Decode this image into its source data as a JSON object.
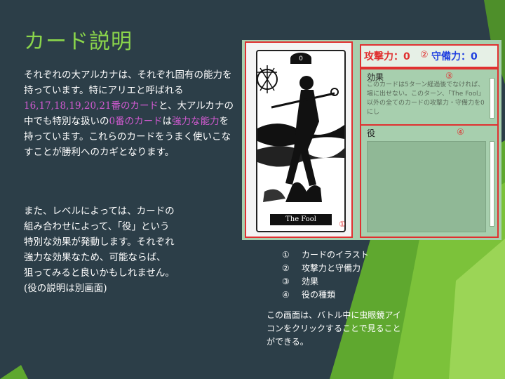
{
  "slide": {
    "title": "カード説明",
    "para1": {
      "a": "それぞれの大アルカナは、それぞれ固有の能力を持っています。特にアリエと呼ばれる",
      "b": "16,17,18,19,20,21番のカード",
      "c": "と、大アルカナの中でも特別な扱いの",
      "d": "0番のカード",
      "e": "は",
      "f": "強力な能力",
      "g": "を持っています。これらのカードをうまく使いこなすことが勝利へのカギとなります。"
    },
    "para2": [
      "また、レベルによっては、カードの",
      "組み合わせによって、「役」という",
      "特別な効果が発動します。それぞれ",
      "強力な効果なため、可能ならば、",
      "狙ってみると良いかもしれません。",
      "(役の説明は別画面)"
    ],
    "legend": [
      {
        "num": "①",
        "label": "カードのイラスト"
      },
      {
        "num": "②",
        "label": "攻撃力と守備力"
      },
      {
        "num": "③",
        "label": "効果"
      },
      {
        "num": "④",
        "label": "役の種類"
      }
    ],
    "note": "この画面は、バトル中に虫眼鏡アイコンをクリックすることで見ることができる。"
  },
  "screenshot": {
    "card_number": "0",
    "card_name": "The Fool",
    "marker1": "①",
    "marker2": "②",
    "marker3": "③",
    "marker4": "④",
    "attack": "攻撃力：0",
    "defense": "守備力：0",
    "effect_title": "効果",
    "effect_text": "このカードは5ターン経過後でなければ、場に出せない。このターン、「The Fool」以外の全てのカードの攻撃力・守備力を0にし",
    "role_title": "役"
  },
  "colors": {
    "background": "#2c3e48",
    "title_green": "#8bd64b",
    "highlight_magenta": "#d05ad0",
    "annotation_red": "#e03030",
    "defense_blue": "#2040e0"
  }
}
